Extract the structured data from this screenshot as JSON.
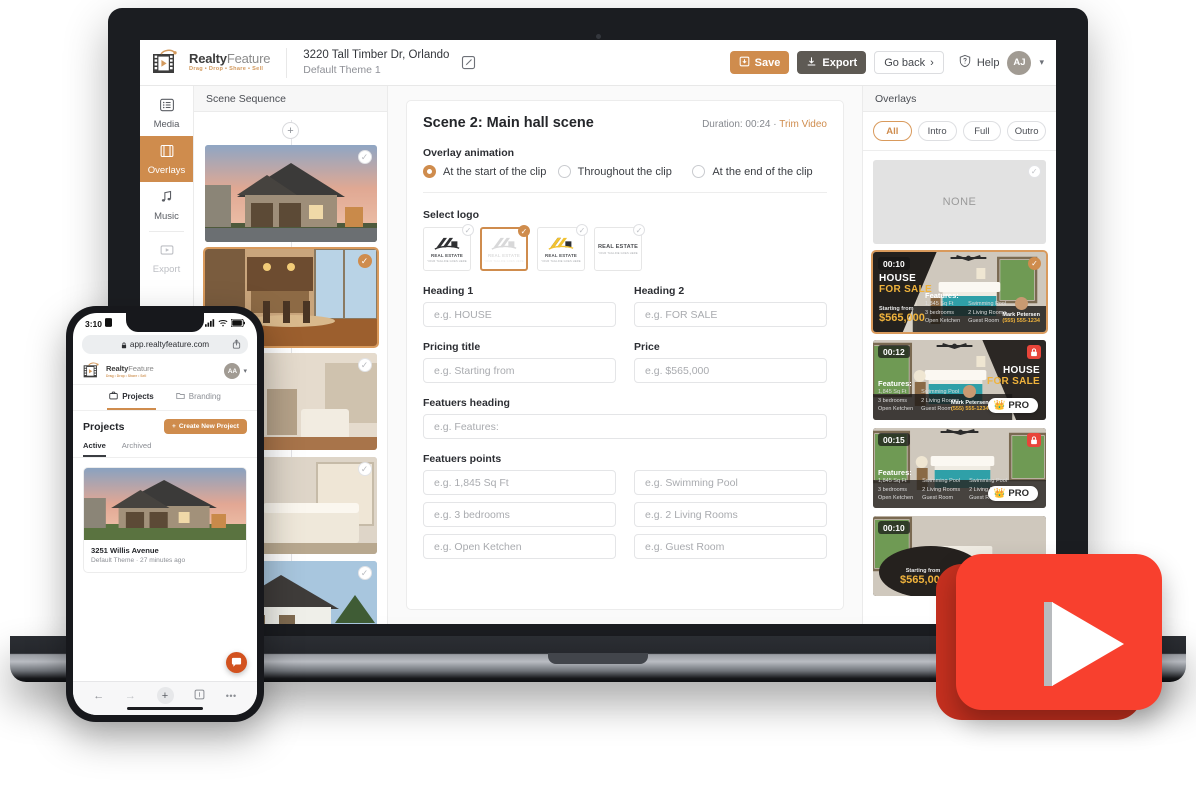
{
  "app": {
    "brand_name_bold": "Realty",
    "brand_name_light": "Feature",
    "brand_tagline": "Drag • Drop • Share • Sell",
    "project_title": "3220 Tall Timber Dr, Orlando",
    "project_theme": "Default Theme 1",
    "edit_icon": "pencil-square-icon"
  },
  "toolbar": {
    "save_label": "Save",
    "save_icon": "save-icon",
    "export_label": "Export",
    "export_icon": "download-icon",
    "goback_label": "Go back",
    "goback_chevron": "›",
    "help_label": "Help",
    "help_icon": "shield-question-icon",
    "avatar_initials": "AJ",
    "avatar_caret": "chevron-down-icon"
  },
  "rail": {
    "items": [
      {
        "label": "Media",
        "icon": "media-list-icon",
        "state": "default"
      },
      {
        "label": "Overlays",
        "icon": "film-strip-icon",
        "state": "active"
      },
      {
        "label": "Music",
        "icon": "music-note-icon",
        "state": "default"
      },
      {
        "label": "Export",
        "icon": "export-play-icon",
        "state": "disabled"
      }
    ]
  },
  "sequence": {
    "title": "Scene Sequence",
    "add_icon": "plus-circle-icon",
    "scenes": [
      {
        "name": "exterior-dusk-house",
        "selected": false
      },
      {
        "name": "kitchen-dining",
        "selected": true
      },
      {
        "name": "twin-bedroom",
        "selected": false
      },
      {
        "name": "master-bedroom",
        "selected": false
      },
      {
        "name": "exterior-daylight-house",
        "selected": false
      }
    ]
  },
  "main": {
    "scene_title": "Scene 2: Main hall scene",
    "duration_label": "Duration: 00:24",
    "duration_sep": "·",
    "trim_label": "Trim Video",
    "animation_label": "Overlay animation",
    "animation_options": [
      {
        "label": "At the start of the clip",
        "selected": true
      },
      {
        "label": "Throughout the clip",
        "selected": false
      },
      {
        "label": "At the end of the clip",
        "selected": false
      }
    ],
    "select_logo_label": "Select logo",
    "logos": [
      {
        "name": "logo-dark-roof",
        "caption": "REAL ESTATE",
        "subcaption": "YOUR TAGLINE GOES HERE",
        "selected": false
      },
      {
        "name": "logo-faded-roof",
        "caption": "REAL ESTATE",
        "subcaption": "YOUR TAGLINE GOES HERE",
        "selected": true
      },
      {
        "name": "logo-yellow-roof",
        "caption": "REAL ESTATE",
        "subcaption": "YOUR TAGLINE GOES HERE",
        "selected": false
      },
      {
        "name": "logo-text-only",
        "caption": "REAL ESTATE",
        "subcaption": "YOUR TAGLINE GOES HERE",
        "selected": false
      }
    ],
    "fields": {
      "heading1_label": "Heading 1",
      "heading1_placeholder": "e.g. HOUSE",
      "heading1_value": "",
      "heading2_label": "Heading 2",
      "heading2_placeholder": "e.g. FOR SALE",
      "heading2_value": "",
      "pricing_title_label": "Pricing title",
      "pricing_title_placeholder": "e.g. Starting from",
      "pricing_title_value": "",
      "price_label": "Price",
      "price_placeholder": "e.g. $565,000",
      "price_value": "",
      "features_heading_label": "Featuers heading",
      "features_heading_placeholder": "e.g. Features:",
      "features_heading_value": "",
      "features_points_label": "Featuers points",
      "points": [
        {
          "placeholder": "e.g. 1,845 Sq Ft",
          "value": ""
        },
        {
          "placeholder": "e.g. Swimming Pool",
          "value": ""
        },
        {
          "placeholder": "e.g. 3 bedrooms",
          "value": ""
        },
        {
          "placeholder": "e.g. 2 Living Rooms",
          "value": ""
        },
        {
          "placeholder": "e.g. Open Ketchen",
          "value": ""
        },
        {
          "placeholder": "e.g. Guest Room",
          "value": ""
        }
      ]
    }
  },
  "overlays": {
    "title": "Overlays",
    "tabs": [
      {
        "label": "All",
        "selected": true
      },
      {
        "label": "Intro",
        "selected": false
      },
      {
        "label": "Full",
        "selected": false
      },
      {
        "label": "Outro",
        "selected": false
      }
    ],
    "none_label": "NONE",
    "cards": [
      {
        "duration": "00:10",
        "selected": true,
        "locked": false,
        "pro": false,
        "heading1": "HOUSE",
        "heading2": "FOR SALE",
        "pricing_title": "Starting from",
        "price": "$565,000",
        "features_heading": "Features:",
        "features": [
          "1,845 Sq Ft",
          "Swimming Pool",
          "3 bedrooms",
          "2 Living Rooms",
          "Open Ketchen",
          "Guest Room"
        ],
        "agent_name": "Mark Petersen",
        "agent_phone": "(555) 555-1234"
      },
      {
        "duration": "00:12",
        "selected": false,
        "locked": true,
        "pro": true,
        "pro_label": "PRO",
        "heading1": "HOUSE",
        "heading2": "FOR SALE",
        "features_heading": "Features:",
        "features": [
          "1,845 Sq Ft",
          "Swimming Pool",
          "3 bedrooms",
          "2 Living Rooms",
          "Open Ketchen",
          "Guest Room"
        ],
        "agent_name": "Mark Petersen",
        "agent_phone": "(555) 555-1234"
      },
      {
        "duration": "00:15",
        "selected": false,
        "locked": true,
        "pro": true,
        "pro_label": "PRO",
        "features_heading": "Features:",
        "features": [
          "1,845 Sq Ft",
          "Swimming Pool",
          "Swimming Pool",
          "3 bedrooms",
          "2 Living Rooms",
          "2 Living Rooms",
          "Open Ketchen",
          "Guest Room",
          "Guest Room"
        ]
      },
      {
        "duration": "00:10",
        "selected": false,
        "locked": false,
        "pro": false,
        "pricing_title": "Starting from",
        "price": "$565,000"
      }
    ]
  },
  "phone": {
    "status_time": "3:10",
    "status_battery_icon": "battery-icon",
    "status_wifi_icon": "wifi-icon",
    "status_signal_icon": "cellular-icon",
    "lock_icon": "lock-icon",
    "url": "app.realtyfeature.com",
    "share_icon": "share-icon",
    "brand_name_bold": "Realty",
    "brand_name_light": "Feature",
    "brand_tagline": "Drag • Drop • Share • Sell",
    "avatar_initials": "AA",
    "tabs": [
      {
        "label": "Projects",
        "icon": "briefcase-icon",
        "selected": true
      },
      {
        "label": "Branding",
        "icon": "folder-icon",
        "selected": false
      }
    ],
    "section_title": "Projects",
    "cta_label": "Create New Project",
    "cta_icon": "plus-icon",
    "subtabs": [
      {
        "label": "Active",
        "selected": true
      },
      {
        "label": "Archived",
        "selected": false
      }
    ],
    "project": {
      "name": "3251 Willis Avenue",
      "theme": "Default Theme",
      "separator": "·",
      "updated": "27 minutes ago"
    },
    "fab_icon": "chat-bubble-icon",
    "bottom_bar": [
      {
        "icon": "back-arrow-icon",
        "glyph": "←"
      },
      {
        "icon": "forward-arrow-icon",
        "glyph": "→"
      },
      {
        "icon": "new-tab-plus-icon",
        "glyph": "+"
      },
      {
        "icon": "tabs-icon",
        "glyph": "❑"
      },
      {
        "icon": "more-dots-icon",
        "glyph": "•••"
      }
    ]
  },
  "badge": {
    "name": "youtube-play-button",
    "color": "#f8402e"
  },
  "colors": {
    "accent": "#cf8c4d",
    "accent_light": "#d99a5c",
    "export_gray": "#5e5a54",
    "lock_red": "#e8453a",
    "gold": "#f0b33c",
    "play_red": "#f8402e"
  }
}
